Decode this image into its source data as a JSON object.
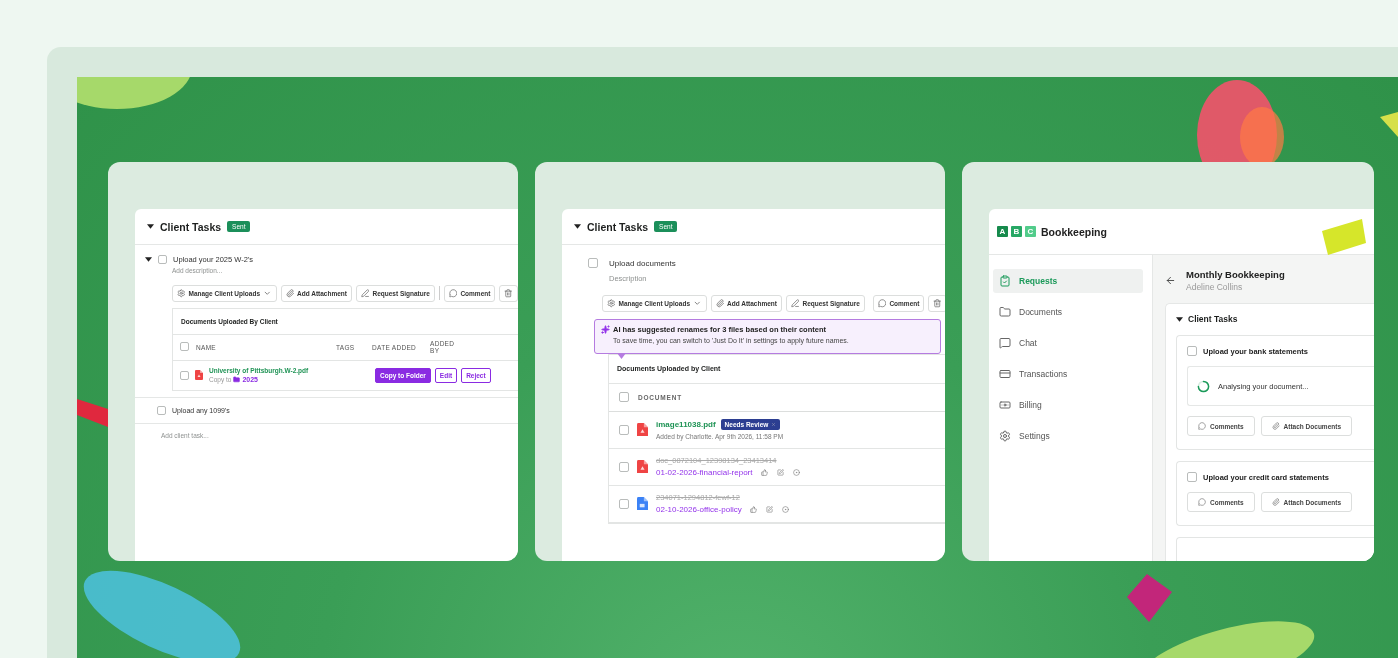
{
  "task_list_screen": {
    "title": "Client Tasks",
    "badge": "Sent",
    "tasks": [
      {
        "label": "Upload your 2025 W-2's",
        "placeholder": "Add description...",
        "checked": false
      },
      {
        "label": "Upload any 1099's",
        "checked": false
      }
    ],
    "toolbar": [
      {
        "kind": "manage",
        "label": "Manage Client Uploads"
      },
      {
        "kind": "attach",
        "label": "Add Attachment"
      },
      {
        "kind": "signature",
        "label": "Request Signature"
      },
      {
        "kind": "comment",
        "label": "Comment"
      },
      {
        "kind": "delete"
      }
    ],
    "table": {
      "title": "Documents Uploaded By Client",
      "select_all_checked": false,
      "columns": [
        "NAME",
        "TAGS",
        "DATE ADDED",
        "ADDED BY"
      ],
      "rows": [
        {
          "name": "University of Pittsburgh.W-2.pdf",
          "copy_label": "Copy to",
          "folder": "2025",
          "checked": false,
          "actions": [
            {
              "kind": "primary",
              "label": "Copy to Folder"
            },
            {
              "kind": "outline",
              "label": "Edit"
            },
            {
              "kind": "outline",
              "label": "Reject"
            }
          ]
        }
      ]
    },
    "add_task_placeholder": "Add client task..."
  },
  "ai_rename_screen": {
    "title": "Client Tasks",
    "badge": "Sent",
    "task": {
      "label": "Upload documents",
      "placeholder": "Description",
      "checked": false
    },
    "toolbar": [
      {
        "kind": "manage",
        "label": "Manage Client Uploads"
      },
      {
        "kind": "attach",
        "label": "Add Attachment"
      },
      {
        "kind": "signature",
        "label": "Request Signature"
      },
      {
        "kind": "comment",
        "label": "Comment"
      },
      {
        "kind": "delete"
      }
    ],
    "notice": {
      "title": "AI has suggested renames for 3 files based on their content",
      "text": "To save time, you can switch to 'Just Do It' in settings to apply future names."
    },
    "table": {
      "title": "Documents Uploaded by Client",
      "select_all_checked": false,
      "column": "DOCUMENT",
      "rows": [
        {
          "kind": "pdf",
          "name": "image11038.pdf",
          "badge": "Needs Review",
          "meta": "Added by Charlotte. Apr 9th 2026, 11:58 PM",
          "checked": false
        },
        {
          "kind": "pdf",
          "original_name": "doc_0872104_12398134_23413414",
          "new_name": "01-02-2026-financial-report",
          "checked": false
        },
        {
          "kind": "doc",
          "original_name": "234071-1294812-fewf-12",
          "new_name": "02-10-2026-office-policy",
          "checked": false
        }
      ]
    }
  },
  "bookkeeping_screen": {
    "logo_letters": [
      "A",
      "B",
      "C"
    ],
    "brand": "Bookkeeping",
    "nav": [
      {
        "kind": "requests",
        "label": "Requests",
        "selected": true
      },
      {
        "kind": "documents",
        "label": "Documents",
        "selected": false
      },
      {
        "kind": "chat",
        "label": "Chat",
        "selected": false
      },
      {
        "kind": "transactions",
        "label": "Transactions",
        "selected": false
      },
      {
        "kind": "billing",
        "label": "Billing",
        "selected": false
      },
      {
        "kind": "settings",
        "label": "Settings",
        "selected": false
      }
    ],
    "title": "Monthly Bookkeeping",
    "client": "Adeline Collins",
    "section": "Client Tasks",
    "tasks": [
      {
        "label": "Upload your bank statements",
        "checked": false,
        "status": "Analysing your document...",
        "actions": [
          {
            "kind": "comments",
            "label": "Comments"
          },
          {
            "kind": "attach",
            "label": "Attach Documents"
          }
        ]
      },
      {
        "label": "Upload your credit card statements",
        "checked": false,
        "actions": [
          {
            "kind": "comments",
            "label": "Comments"
          },
          {
            "kind": "attach",
            "label": "Attach Documents"
          }
        ]
      }
    ]
  }
}
